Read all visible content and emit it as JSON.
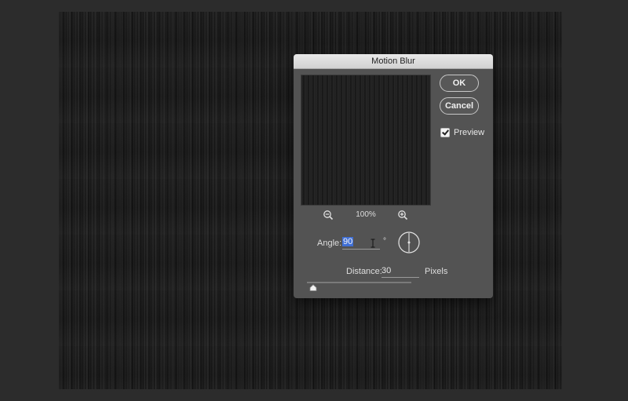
{
  "dialog": {
    "title": "Motion Blur",
    "ok_label": "OK",
    "cancel_label": "Cancel",
    "preview_label": "Preview",
    "preview_checked": true,
    "zoom_level": "100%",
    "angle": {
      "label": "Angle:",
      "value": "90",
      "unit": "°"
    },
    "distance": {
      "label": "Distance:",
      "value": "30",
      "unit": "Pixels",
      "slider_fraction": 0.06
    }
  },
  "icons": {
    "zoom_out": "zoom-out-icon",
    "zoom_in": "zoom-in-icon",
    "text_cursor": "text-cursor-icon",
    "angle_dial": "angle-dial-icon",
    "slider_thumb": "slider-thumb-icon"
  },
  "colors": {
    "dialog_bg": "#535353",
    "selection": "#3f6fd6",
    "canvas": "#141414"
  }
}
